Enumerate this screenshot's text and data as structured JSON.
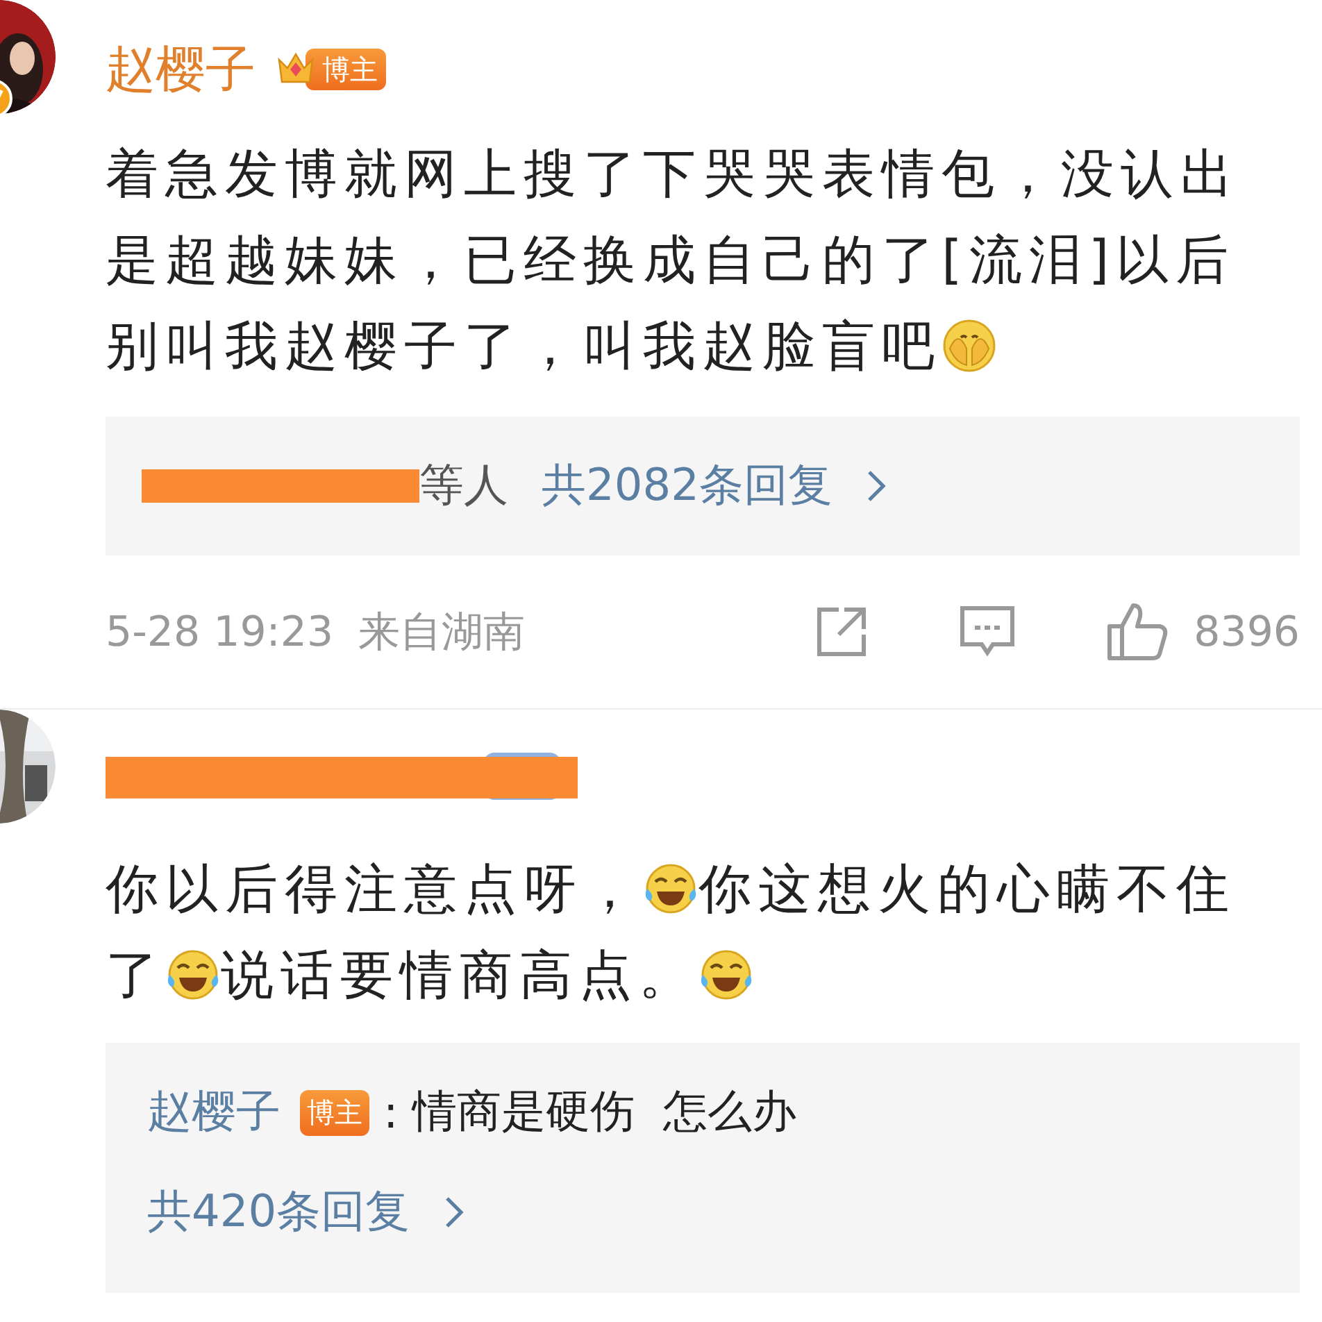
{
  "comments": [
    {
      "author": "赵樱子",
      "avatar_verified": true,
      "badge": {
        "label": "博主"
      },
      "body": [
        [
          {
            "kind": "text",
            "text": "着急发博就网上搜了下哭哭表情包，没认出"
          }
        ],
        [
          {
            "kind": "text",
            "text": "是超越妹妹，已经换成自己的了[流泪]以后"
          }
        ],
        [
          {
            "kind": "text",
            "text": "别叫我赵樱子了，叫我赵脸盲吧"
          },
          {
            "kind": "cover_emoji"
          }
        ]
      ],
      "reply_summary": {
        "names_hidden": true,
        "suffix": "等人",
        "count": "共2082条回复"
      },
      "footer": {
        "time": "5-28 19:23",
        "location": "来自湖南",
        "likes": "8396"
      }
    },
    {
      "author_hidden": true,
      "body": [
        [
          {
            "kind": "text",
            "text": "你以后得注意点呀，"
          },
          {
            "kind": "laugh_emoji"
          },
          {
            "kind": "text",
            "text": "你这想火的心瞒不住"
          }
        ],
        [
          {
            "kind": "text",
            "text": "了"
          },
          {
            "kind": "laugh_emoji"
          },
          {
            "kind": "text",
            "text": "说话要情商高点。"
          },
          {
            "kind": "laugh_emoji"
          }
        ]
      ],
      "reply": {
        "author": "赵樱子",
        "badge": "博主",
        "separator": ":",
        "text": "情商是硬伤  怎么办",
        "count": "共420条回复"
      }
    }
  ]
}
